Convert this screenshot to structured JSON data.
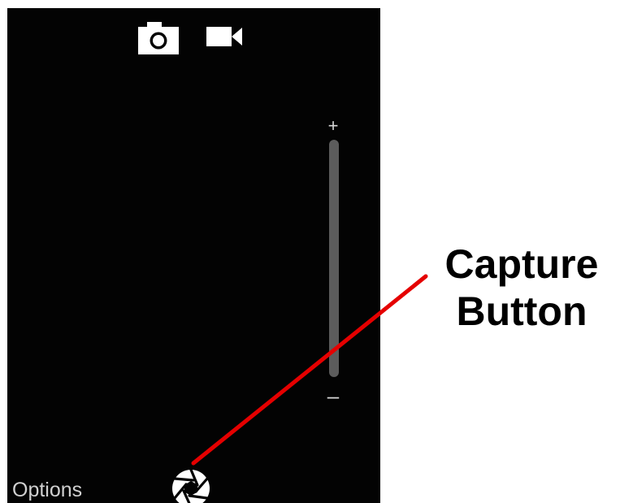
{
  "camera": {
    "modes": [
      {
        "name": "photo",
        "icon": "camera-icon"
      },
      {
        "name": "video",
        "icon": "video-camera-icon"
      }
    ],
    "zoom": {
      "plus_label": "+",
      "minus_label": "–"
    },
    "options_label": "Options",
    "capture_icon": "shutter-aperture-icon"
  },
  "annotation": {
    "line1": "Capture",
    "line2": "Button",
    "line_color": "#e50000"
  },
  "colors": {
    "screen_background": "#030303",
    "icon_color": "#ffffff",
    "zoom_track": "#5c5c5c",
    "callout_text": "#000000"
  }
}
